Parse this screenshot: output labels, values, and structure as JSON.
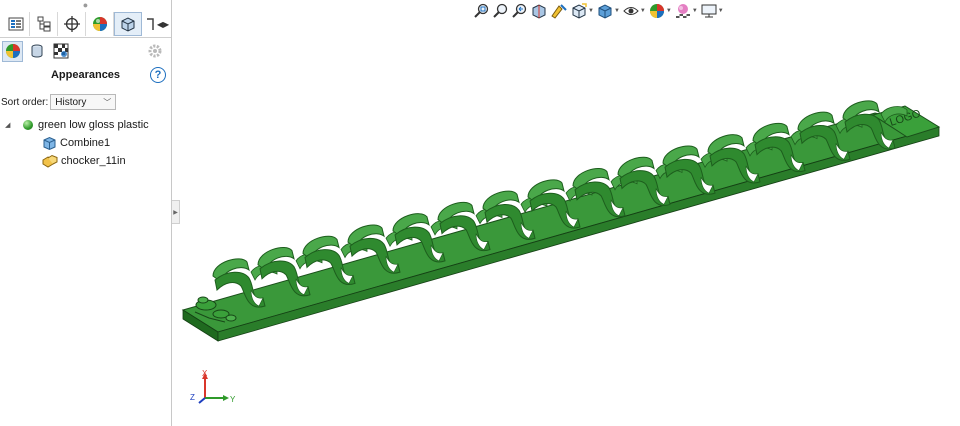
{
  "panel": {
    "title": "Appearances",
    "help_label": "?",
    "sort_label": "Sort order:",
    "sort_value": "History",
    "tree": {
      "material": "green low gloss plastic",
      "children": [
        "Combine1",
        "chocker_11in"
      ]
    }
  },
  "triad": {
    "x": "X",
    "y": "Y",
    "z": "Z"
  },
  "colors": {
    "model_green": "#2f8a2f",
    "model_dark": "#1d5e1d",
    "model_light": "#4aa84a",
    "panel_border": "#c8c8c8",
    "accent_blue": "#1d6fbf"
  },
  "hud_icons": [
    "zoom-to-fit-icon",
    "zoom-to-area-icon",
    "previous-view-icon",
    "section-view-icon",
    "dynamic-annotation-icon",
    "view-orientation-icon",
    "display-style-icon",
    "hide-show-items-icon",
    "edit-appearance-icon",
    "apply-scene-icon",
    "view-settings-icon"
  ]
}
